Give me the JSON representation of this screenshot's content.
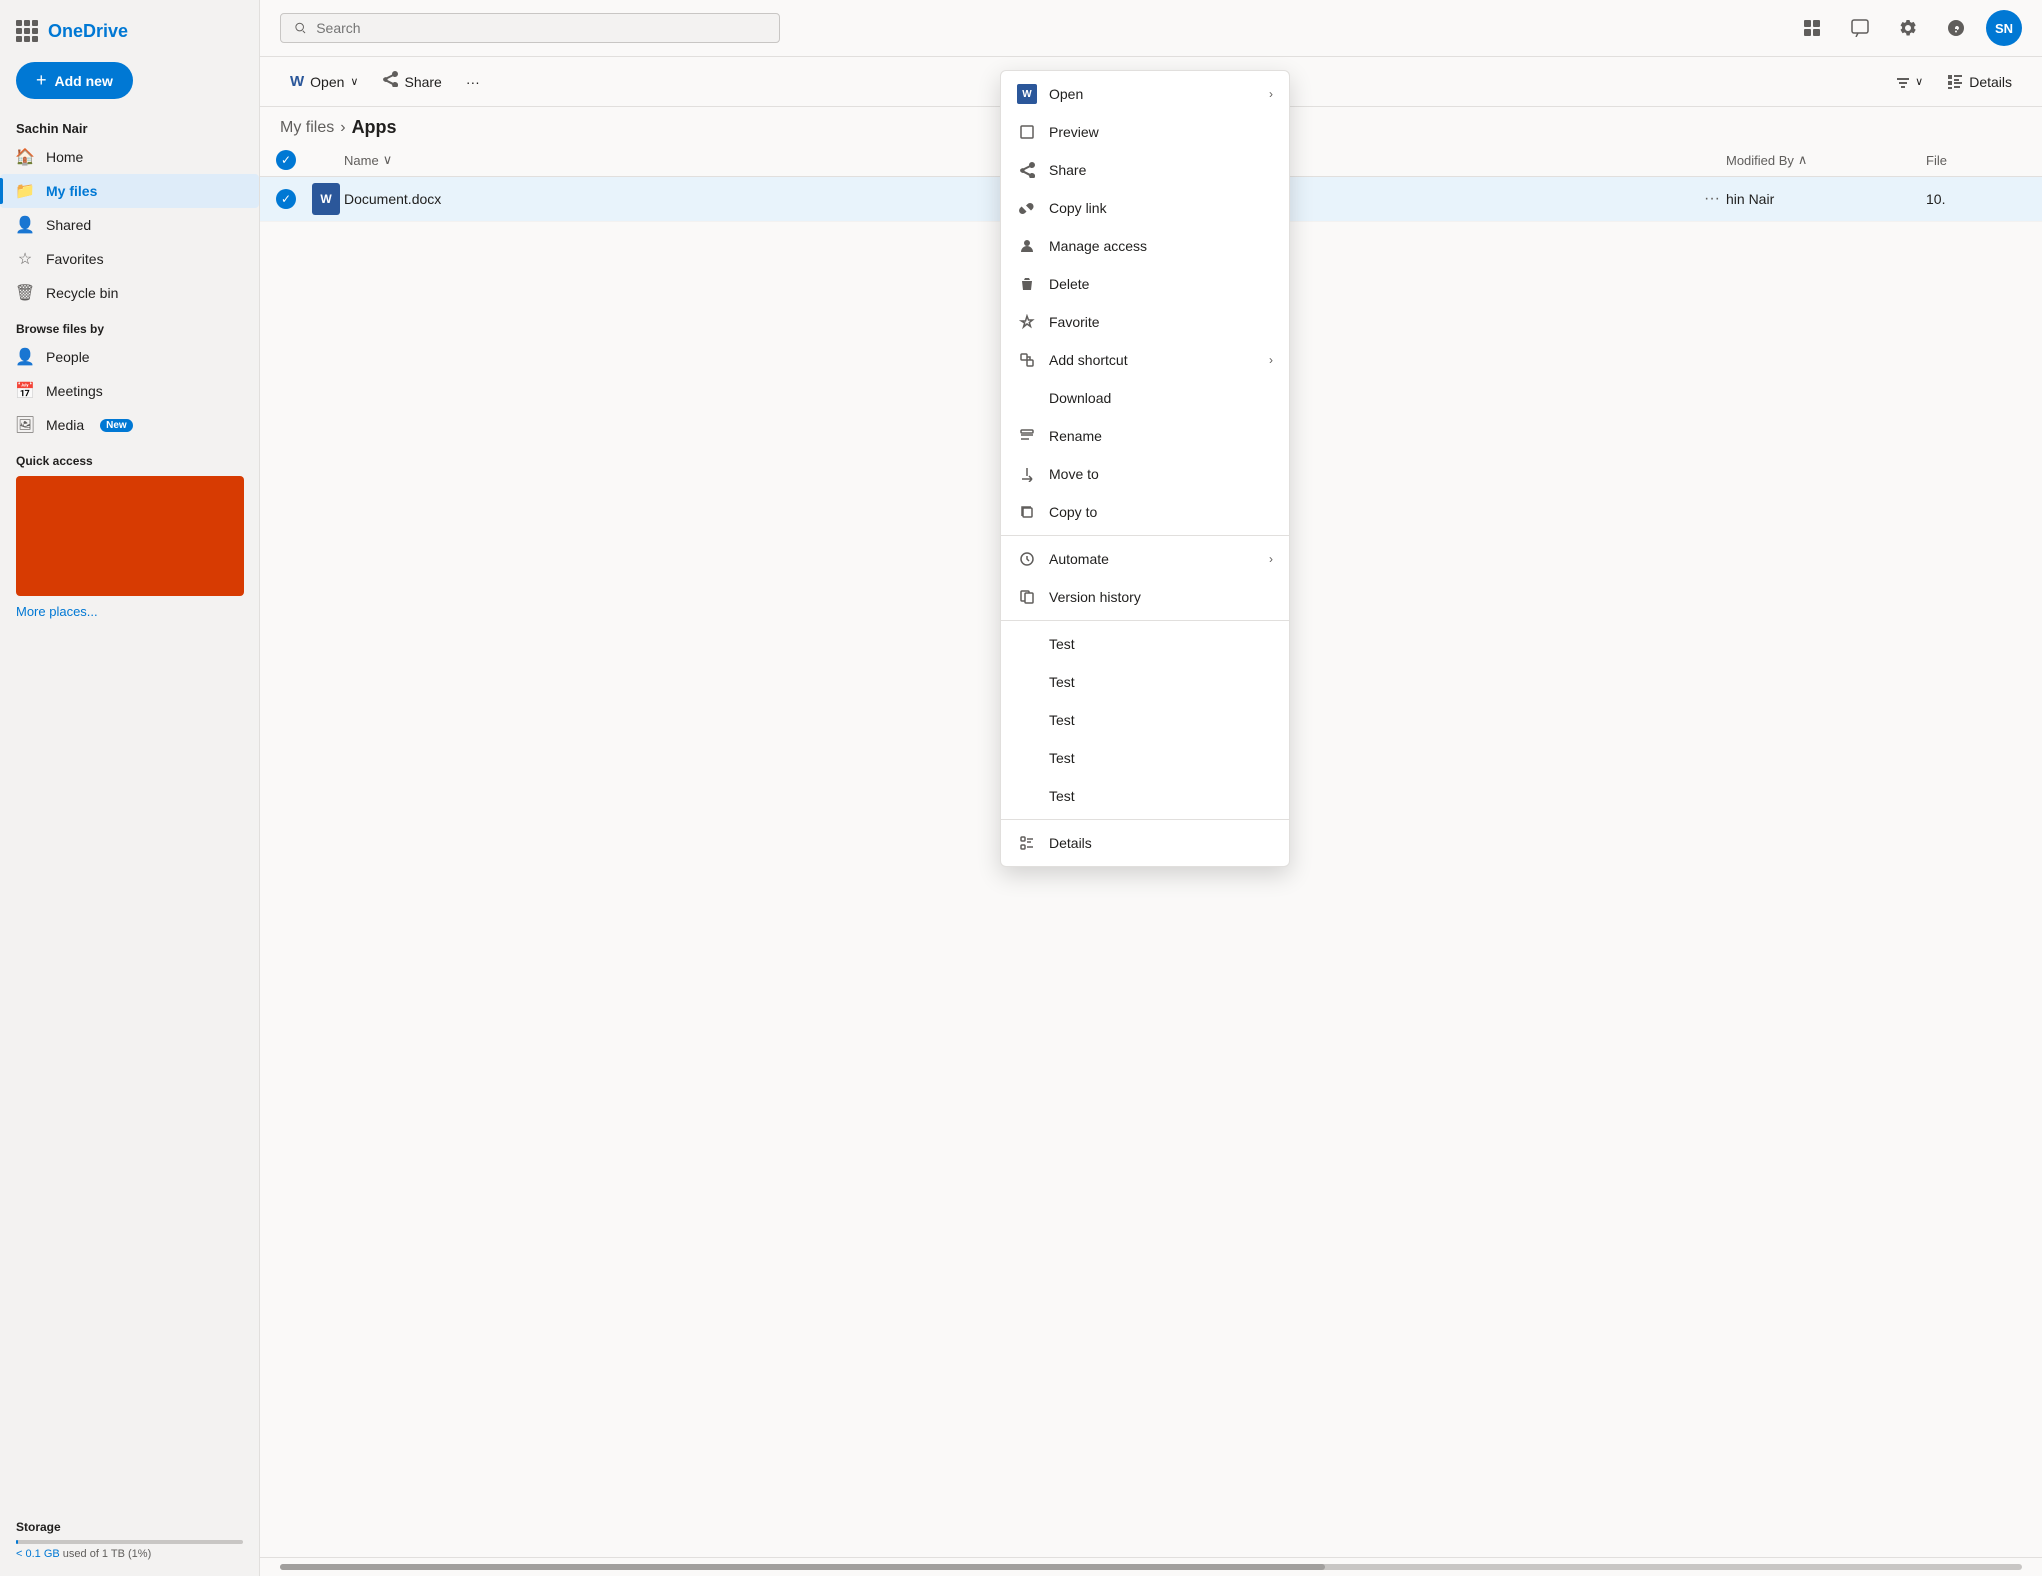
{
  "app": {
    "brand": "OneDrive",
    "search_placeholder": "Search"
  },
  "user": {
    "name": "Sachin Nair",
    "avatar": "SN"
  },
  "sidebar": {
    "add_new_label": "+ Add new",
    "nav_items": [
      {
        "id": "home",
        "label": "Home",
        "icon": "🏠"
      },
      {
        "id": "my-files",
        "label": "My files",
        "icon": "📁",
        "active": true
      },
      {
        "id": "shared",
        "label": "Shared",
        "icon": "👤"
      },
      {
        "id": "favorites",
        "label": "Favorites",
        "icon": "⭐"
      },
      {
        "id": "recycle-bin",
        "label": "Recycle bin",
        "icon": "🗑️"
      }
    ],
    "browse_label": "Browse files by",
    "browse_items": [
      {
        "id": "people",
        "label": "People",
        "icon": "👤"
      },
      {
        "id": "meetings",
        "label": "Meetings",
        "icon": "📅"
      },
      {
        "id": "media",
        "label": "Media",
        "icon": "🖼️",
        "badge": "New"
      }
    ],
    "quick_access_label": "Quick access",
    "more_places_label": "More places...",
    "storage_label": "Storage",
    "storage_used": "< 0.1 GB used of 1 TB (1%)"
  },
  "breadcrumb": {
    "parent": "My files",
    "current": "Apps",
    "separator": "›"
  },
  "toolbar": {
    "open_label": "Open",
    "open_caret": "∨",
    "share_label": "Share",
    "more_label": "···",
    "details_label": "Details"
  },
  "file_list": {
    "columns": {
      "name": "Name",
      "name_sort": "∨",
      "modified_by": "Modified By",
      "modified_by_sort": "∧",
      "file_size": "File"
    },
    "rows": [
      {
        "name": "Document.docx",
        "modified_by": "hin Nair",
        "file_size": "10."
      }
    ]
  },
  "context_menu": {
    "items": [
      {
        "id": "open",
        "label": "Open",
        "icon": "W",
        "type": "word",
        "has_submenu": true
      },
      {
        "id": "preview",
        "label": "Preview",
        "icon": "□",
        "type": "outline"
      },
      {
        "id": "share",
        "label": "Share",
        "icon": "↗",
        "type": "share"
      },
      {
        "id": "copy-link",
        "label": "Copy link",
        "icon": "🔗",
        "type": "icon"
      },
      {
        "id": "manage-access",
        "label": "Manage access",
        "icon": "👤",
        "type": "icon"
      },
      {
        "id": "delete",
        "label": "Delete",
        "icon": "🗑",
        "type": "icon"
      },
      {
        "id": "favorite",
        "label": "Favorite",
        "icon": "☆",
        "type": "icon"
      },
      {
        "id": "add-shortcut",
        "label": "Add shortcut",
        "icon": "⊞",
        "type": "icon",
        "has_submenu": true
      },
      {
        "id": "download",
        "label": "Download",
        "icon": "↓",
        "type": "icon"
      },
      {
        "id": "rename",
        "label": "Rename",
        "icon": "✏",
        "type": "icon"
      },
      {
        "id": "move-to",
        "label": "Move to",
        "icon": "⤷",
        "type": "icon"
      },
      {
        "id": "copy-to",
        "label": "Copy to",
        "icon": "⧉",
        "type": "icon"
      },
      {
        "id": "separator1",
        "type": "separator"
      },
      {
        "id": "automate",
        "label": "Automate",
        "icon": "⟳",
        "type": "icon",
        "has_submenu": true
      },
      {
        "id": "version-history",
        "label": "Version history",
        "icon": "⧉",
        "type": "icon"
      },
      {
        "id": "separator2",
        "type": "separator"
      },
      {
        "id": "test1",
        "label": "Test",
        "icon": "",
        "type": "plain"
      },
      {
        "id": "test2",
        "label": "Test",
        "icon": "",
        "type": "plain"
      },
      {
        "id": "test3",
        "label": "Test",
        "icon": "",
        "type": "plain"
      },
      {
        "id": "test4",
        "label": "Test",
        "icon": "",
        "type": "plain"
      },
      {
        "id": "test5",
        "label": "Test",
        "icon": "",
        "type": "plain"
      },
      {
        "id": "separator3",
        "type": "separator"
      },
      {
        "id": "details",
        "label": "Details",
        "icon": "ℹ",
        "type": "icon"
      }
    ]
  },
  "colors": {
    "accent": "#0078d4",
    "quick_access_thumb": "#d73b02"
  }
}
